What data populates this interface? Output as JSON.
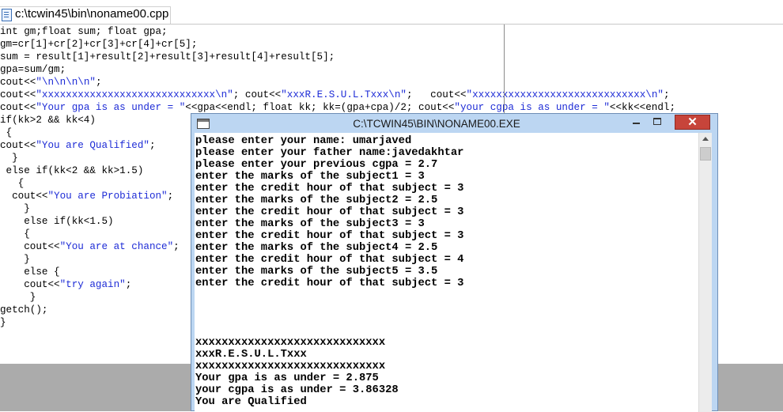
{
  "editor": {
    "tab_title": "c:\\tcwin45\\bin\\noname00.cpp",
    "lines": [
      [
        "int gm;float sum; float gpa;"
      ],
      [
        "gm=cr[1]+cr[2]+cr[3]+cr[4]+cr[5];"
      ],
      [
        "sum = result[1]+result[2]+result[3]+result[4]+result[5];"
      ],
      [
        "gpa=sum/gm;"
      ],
      [
        "cout<<",
        "\"\\n\\n\\n\\n\"",
        ";"
      ],
      [
        "cout<<",
        "\"xxxxxxxxxxxxxxxxxxxxxxxxxxxxx\\n\"",
        "; cout<<",
        "\"xxxR.E.S.U.L.Txxx\\n\"",
        ";   cout<<",
        "\"xxxxxxxxxxxxxxxxxxxxxxxxxxxxx\\n\"",
        ";"
      ],
      [
        "cout<<",
        "\"Your gpa is as under = \"",
        "<<gpa<<endl; float kk; kk=(gpa+cpa)/2; cout<<",
        "\"your cgpa is as under = \"",
        "<<kk<<endl;"
      ],
      [
        "if(kk>2 && kk<4)"
      ],
      [
        " {"
      ],
      [
        "cout<<",
        "\"You are Qualified\"",
        ";"
      ],
      [
        "  }"
      ],
      [
        " else if(kk<2 && kk>1.5)"
      ],
      [
        "   {"
      ],
      [
        "  cout<<",
        "\"You are Probiation\"",
        ";"
      ],
      [
        "    }"
      ],
      [
        "    else if(kk<1.5)"
      ],
      [
        "    {"
      ],
      [
        "    cout<<",
        "\"You are at chance\"",
        ";"
      ],
      [
        "    }"
      ],
      [
        "    else {"
      ],
      [
        "    cout<<",
        "\"try again\"",
        ";"
      ],
      [
        "     }"
      ],
      [
        "getch();"
      ],
      [
        "}"
      ]
    ]
  },
  "console": {
    "title": "C:\\TCWIN45\\BIN\\NONAME00.EXE",
    "close_glyph": "✕",
    "lines": [
      "please enter your name: umarjaved",
      "please enter your father name:javedakhtar",
      "please enter your previous cgpa = 2.7",
      "enter the marks of the subject1 = 3",
      "enter the credit hour of that subject = 3",
      "enter the marks of the subject2 = 2.5",
      "enter the credit hour of that subject = 3",
      "enter the marks of the subject3 = 3",
      "enter the credit hour of that subject = 3",
      "enter the marks of the subject4 = 2.5",
      "enter the credit hour of that subject = 4",
      "enter the marks of the subject5 = 3.5",
      "enter the credit hour of that subject = 3",
      "",
      "",
      "",
      "",
      "xxxxxxxxxxxxxxxxxxxxxxxxxxxxx",
      "xxxR.E.S.U.L.Txxx",
      "xxxxxxxxxxxxxxxxxxxxxxxxxxxxx",
      "Your gpa is as under = 2.875",
      "your cgpa is as under = 3.86328",
      "You are Qualified"
    ]
  },
  "icons": {
    "file": "file-icon",
    "console": "console-icon",
    "minimize": "minimize-icon",
    "maximize": "maximize-icon",
    "close": "close-icon",
    "scroll_up": "chevron-up-icon"
  },
  "colors": {
    "string_literal": "#1d2bd6",
    "close_button": "#c7443a",
    "title_bar": "#bcd6f2"
  }
}
